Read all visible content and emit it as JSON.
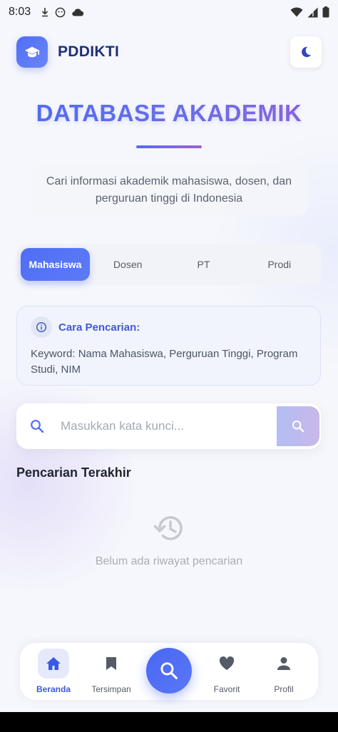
{
  "status_bar": {
    "time": "8:03"
  },
  "header": {
    "app_title": "PDDIKTI"
  },
  "hero": {
    "title": "DATABASE AKADEMIK",
    "subtitle": "Cari informasi akademik mahasiswa, dosen, dan perguruan tinggi di Indonesia"
  },
  "tabs": [
    {
      "label": "Mahasiswa",
      "active": true
    },
    {
      "label": "Dosen",
      "active": false
    },
    {
      "label": "PT",
      "active": false
    },
    {
      "label": "Prodi",
      "active": false
    }
  ],
  "info": {
    "title": "Cara Pencarian:",
    "text": "Keyword: Nama Mahasiswa, Perguruan Tinggi, Program Studi, NIM"
  },
  "search": {
    "placeholder": "Masukkan kata kunci..."
  },
  "recent": {
    "title": "Pencarian Terakhir",
    "empty_text": "Belum ada riwayat pencarian"
  },
  "bottom_nav": {
    "items": [
      {
        "label": "Beranda",
        "icon": "home-icon",
        "active": true
      },
      {
        "label": "Tersimpan",
        "icon": "bookmark-icon",
        "active": false
      },
      {
        "label": "Favorit",
        "icon": "heart-icon",
        "active": false
      },
      {
        "label": "Profil",
        "icon": "person-icon",
        "active": false
      }
    ]
  },
  "colors": {
    "primary": "#4f6ef5",
    "accent_purple": "#a25fd6",
    "title_dark": "#1e2f7a",
    "info_blue": "#4158d8"
  }
}
